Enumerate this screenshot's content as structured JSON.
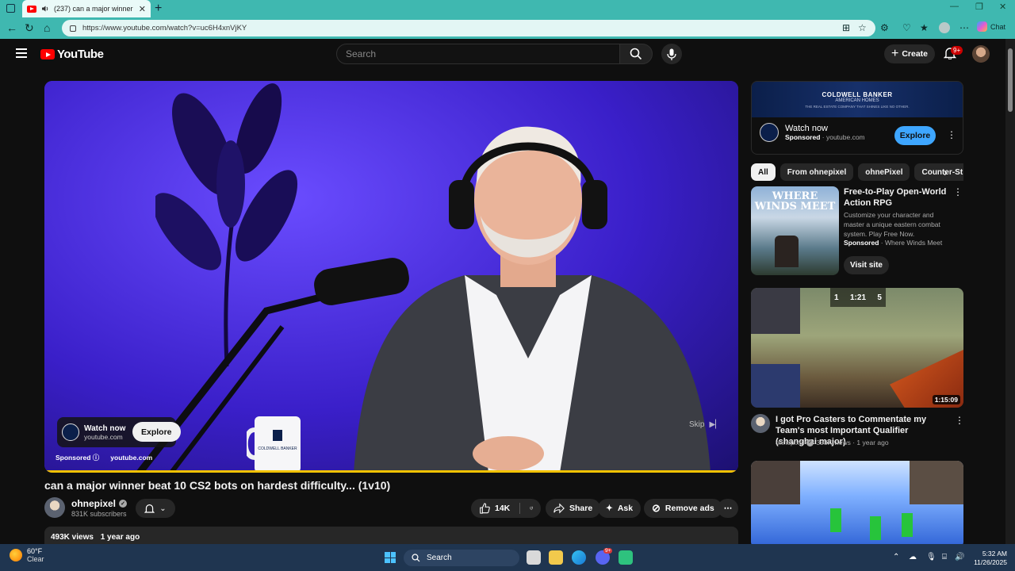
{
  "browser": {
    "tab_title": "(237) can a major winner beat",
    "url": "https://www.youtube.com/watch?v=uc6H4xnVjKY",
    "chat_label": "Chat"
  },
  "youtube": {
    "logo_text": "YouTube",
    "search_placeholder": "Search",
    "create_label": "Create",
    "notif_count": "9+"
  },
  "player": {
    "ad_card_title": "Watch now",
    "ad_card_domain": "youtube.com",
    "explore_label": "Explore",
    "sponsored_label": "Sponsored",
    "sponsored_domain": "youtube.com",
    "skip_label": "Skip",
    "mug_text": "COLDWELL BANKER",
    "progress": 1.0
  },
  "video": {
    "title": "can a major winner beat 10 CS2 bots on hardest difficulty... (1v10)",
    "channel": "ohnepixel",
    "subscribers": "831K subscribers",
    "likes": "14K",
    "share": "Share",
    "ask": "Ask",
    "remove_ads": "Remove ads",
    "views": "493K views",
    "age": "1 year ago"
  },
  "sidebar": {
    "ad": {
      "banner_line1": "COLDWELL BANKER",
      "banner_line2": "AMERICAN HOMES",
      "banner_line3": "THE REAL ESTATE COMPANY THAT SHINES LIKE NO OTHER.",
      "watch": "Watch now",
      "sponsored": "Sponsored",
      "domain": "· youtube.com",
      "explore": "Explore"
    },
    "chips": [
      "All",
      "From ohnepixel",
      "ohnePixel",
      "Counter-St"
    ],
    "promo": {
      "title": "Free-to-Play Open-World Action RPG",
      "desc": "Customize your character and master a unique eastern combat system. Play Free Now.",
      "sponsored": "Sponsored",
      "advertiser": "· Where Winds Meet",
      "visit": "Visit site",
      "thumb_title": "WHERE WINDS MEET"
    },
    "video1": {
      "title": "I got Pro Casters to Commentate my Team's most Important Qualifier (shanghai major)",
      "channel": "ohnepixel",
      "meta": "398K views · 1 year ago",
      "duration": "1:15:09",
      "hud_time": "1:21",
      "hud_left": "1",
      "hud_right": "5"
    }
  },
  "taskbar": {
    "temp": "60°F",
    "condition": "Clear",
    "search": "Search",
    "time": "5:32 AM",
    "date": "11/26/2025",
    "discord_badge": "9+"
  },
  "colors": {
    "accent_blue": "#3ea6ff",
    "yt_red": "#ff0000",
    "progress_yellow": "#f2c200",
    "browser_teal": "#3fb8b0"
  }
}
